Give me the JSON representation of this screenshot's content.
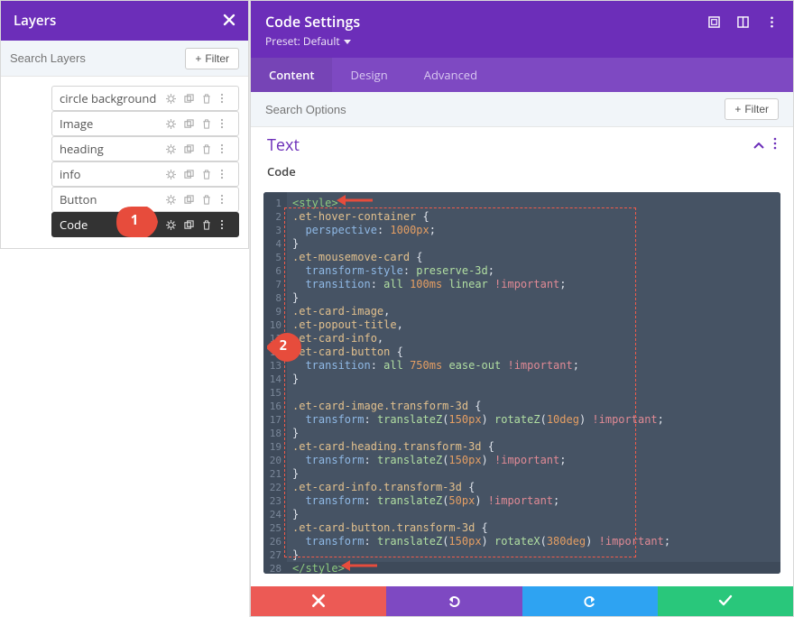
{
  "layers": {
    "title": "Layers",
    "search_placeholder": "Search Layers",
    "filter_label": "Filter",
    "items": [
      {
        "label": "circle background",
        "active": false
      },
      {
        "label": "Image",
        "active": false
      },
      {
        "label": "heading",
        "active": false
      },
      {
        "label": "info",
        "active": false
      },
      {
        "label": "Button",
        "active": false
      },
      {
        "label": "Code",
        "active": true
      }
    ]
  },
  "settings": {
    "title": "Code Settings",
    "preset": "Preset: Default",
    "tabs": [
      {
        "label": "Content",
        "active": true
      },
      {
        "label": "Design",
        "active": false
      },
      {
        "label": "Advanced",
        "active": false
      }
    ],
    "search_placeholder": "Search Options",
    "filter_label": "Filter",
    "section_title": "Text",
    "code_label": "Code"
  },
  "code": {
    "tokens": [
      [
        [
          "kw-tag",
          "<style>"
        ]
      ],
      [
        [
          "kw-sel",
          ".et-hover-container "
        ],
        [
          "",
          "{"
        ]
      ],
      [
        [
          "",
          "  "
        ],
        [
          "kw-prop",
          "perspective"
        ],
        [
          "",
          ": "
        ],
        [
          "kw-num",
          "1000px"
        ],
        [
          "",
          ";"
        ]
      ],
      [
        [
          "",
          "}"
        ]
      ],
      [
        [
          "kw-sel",
          ".et-mousemove-card "
        ],
        [
          "",
          "{"
        ]
      ],
      [
        [
          "",
          "  "
        ],
        [
          "kw-prop",
          "transform-style"
        ],
        [
          "",
          ": "
        ],
        [
          "kw-val",
          "preserve-3d"
        ],
        [
          "",
          ";"
        ]
      ],
      [
        [
          "",
          "  "
        ],
        [
          "kw-prop",
          "transition"
        ],
        [
          "",
          ": "
        ],
        [
          "kw-val",
          "all"
        ],
        [
          "",
          " "
        ],
        [
          "kw-num",
          "100ms"
        ],
        [
          "",
          " "
        ],
        [
          "kw-val",
          "linear"
        ],
        [
          "",
          " "
        ],
        [
          "kw-imp",
          "!important"
        ],
        [
          "",
          ";"
        ]
      ],
      [
        [
          "",
          "}"
        ]
      ],
      [
        [
          "kw-sel",
          ".et-card-image"
        ],
        [
          "",
          ","
        ]
      ],
      [
        [
          "kw-sel",
          ".et-popout-title"
        ],
        [
          "",
          ","
        ]
      ],
      [
        [
          "kw-sel",
          ".et-card-info"
        ],
        [
          "",
          ","
        ]
      ],
      [
        [
          "kw-sel",
          ".et-card-button "
        ],
        [
          "",
          "{"
        ]
      ],
      [
        [
          "",
          "  "
        ],
        [
          "kw-prop",
          "transition"
        ],
        [
          "",
          ": "
        ],
        [
          "kw-val",
          "all"
        ],
        [
          "",
          " "
        ],
        [
          "kw-num",
          "750ms"
        ],
        [
          "",
          " "
        ],
        [
          "kw-val",
          "ease-out"
        ],
        [
          "",
          " "
        ],
        [
          "kw-imp",
          "!important"
        ],
        [
          "",
          ";"
        ]
      ],
      [
        [
          "",
          "}"
        ]
      ],
      [
        [
          "",
          ""
        ]
      ],
      [
        [
          "kw-sel",
          ".et-card-image.transform-3d "
        ],
        [
          "",
          "{"
        ]
      ],
      [
        [
          "",
          "  "
        ],
        [
          "kw-prop",
          "transform"
        ],
        [
          "",
          ": "
        ],
        [
          "kw-val",
          "translateZ"
        ],
        [
          "",
          "("
        ],
        [
          "kw-num",
          "150px"
        ],
        [
          "",
          ") "
        ],
        [
          "kw-val",
          "rotateZ"
        ],
        [
          "",
          "("
        ],
        [
          "kw-num",
          "10deg"
        ],
        [
          "",
          ") "
        ],
        [
          "kw-imp",
          "!important"
        ],
        [
          "",
          ";"
        ]
      ],
      [
        [
          "",
          "}"
        ]
      ],
      [
        [
          "kw-sel",
          ".et-card-heading.transform-3d "
        ],
        [
          "",
          "{"
        ]
      ],
      [
        [
          "",
          "  "
        ],
        [
          "kw-prop",
          "transform"
        ],
        [
          "",
          ": "
        ],
        [
          "kw-val",
          "translateZ"
        ],
        [
          "",
          "("
        ],
        [
          "kw-num",
          "150px"
        ],
        [
          "",
          ") "
        ],
        [
          "kw-imp",
          "!important"
        ],
        [
          "",
          ";"
        ]
      ],
      [
        [
          "",
          "}"
        ]
      ],
      [
        [
          "kw-sel",
          ".et-card-info.transform-3d "
        ],
        [
          "",
          "{"
        ]
      ],
      [
        [
          "",
          "  "
        ],
        [
          "kw-prop",
          "transform"
        ],
        [
          "",
          ": "
        ],
        [
          "kw-val",
          "translateZ"
        ],
        [
          "",
          "("
        ],
        [
          "kw-num",
          "50px"
        ],
        [
          "",
          ") "
        ],
        [
          "kw-imp",
          "!important"
        ],
        [
          "",
          ";"
        ]
      ],
      [
        [
          "",
          "}"
        ]
      ],
      [
        [
          "kw-sel",
          ".et-card-button.transform-3d "
        ],
        [
          "",
          "{"
        ]
      ],
      [
        [
          "",
          "  "
        ],
        [
          "kw-prop",
          "transform"
        ],
        [
          "",
          ": "
        ],
        [
          "kw-val",
          "translateZ"
        ],
        [
          "",
          "("
        ],
        [
          "kw-num",
          "150px"
        ],
        [
          "",
          ") "
        ],
        [
          "kw-val",
          "rotateX"
        ],
        [
          "",
          "("
        ],
        [
          "kw-num",
          "380deg"
        ],
        [
          "",
          ") "
        ],
        [
          "kw-imp",
          "!important"
        ],
        [
          "",
          ";"
        ]
      ],
      [
        [
          "",
          "}"
        ]
      ],
      [
        [
          "kw-tag",
          "</style>"
        ]
      ]
    ]
  },
  "annotations": {
    "marker1": "1",
    "marker2": "2"
  }
}
